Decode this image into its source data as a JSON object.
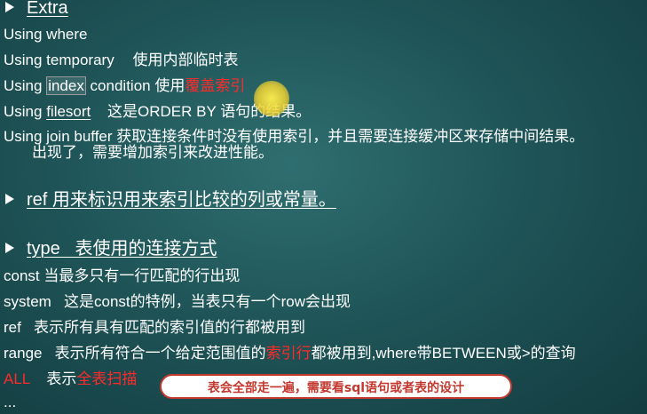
{
  "extra": {
    "heading": "Extra",
    "using_where": "Using where",
    "using_temporary": {
      "label": "Using temporary",
      "desc": "使用内部临时表"
    },
    "using_index_condition": {
      "pre": "Using ",
      "boxed": "index",
      "post": " condition 使用",
      "red": "覆盖索引"
    },
    "using_filesort": {
      "pre": "Using ",
      "link": "filesort",
      "desc": "这是ORDER BY 语句的结果。"
    },
    "using_join_buffer": {
      "line1": "Using join buffer 获取连接条件时没有使用索引，并且需要连接缓冲区来存储中间结果。",
      "line2": "出现了，需要增加索引来改进性能。"
    }
  },
  "ref": {
    "heading": "ref 用来标识用来索引比较的列或常量。"
  },
  "type": {
    "heading": "type   表使用的连接方式",
    "const": "const 当最多只有一行匹配的行出现",
    "system": "system   这是const的特例，当表只有一个row会出现",
    "ref": "ref   表示所有具有匹配的索引值的行都被用到",
    "range": {
      "pre": "range   表示所有符合一个给定范围值的",
      "red": "索引行",
      "post": "都被用到,where带BETWEEN或>的查询"
    },
    "all": {
      "label": "ALL",
      "pre": "表示",
      "red": "全表扫描"
    },
    "more": "..."
  },
  "callout": "表会全部走一遍，需要看sql语句或者表的设计",
  "colors": {
    "background": "#1f5558",
    "highlight_red": "#ff2a2a",
    "callout_border": "#c4392f",
    "pointer": "#f0d232"
  }
}
